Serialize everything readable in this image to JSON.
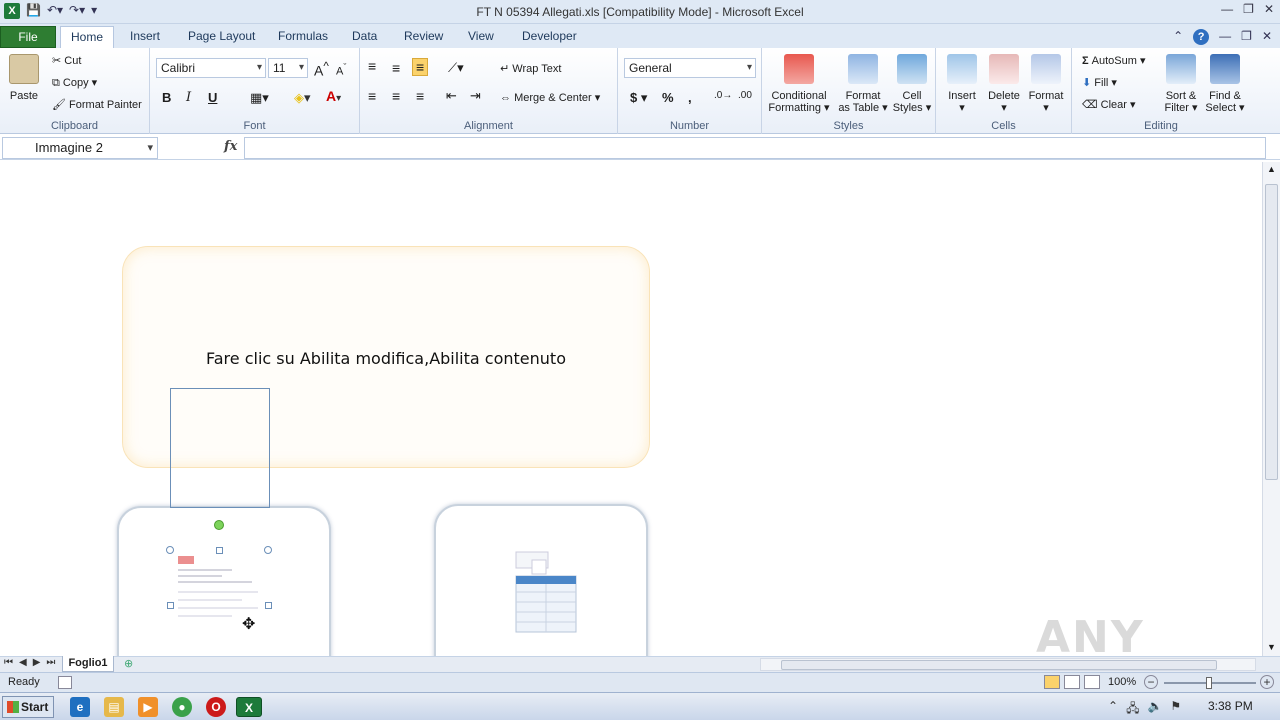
{
  "window": {
    "title": "FT N 05394 Allegati.xls  [Compatibility Mode]  -  Microsoft Excel",
    "app_icon_label": "X"
  },
  "ribbon_tabs": [
    "File",
    "Home",
    "Insert",
    "Page Layout",
    "Formulas",
    "Data",
    "Review",
    "View",
    "Developer"
  ],
  "active_tab": "Home",
  "clipboard": {
    "paste": "Paste",
    "cut": "Cut",
    "copy": "Copy",
    "format_painter": "Format Painter",
    "group": "Clipboard"
  },
  "font": {
    "name": "Calibri",
    "size": "11",
    "bold": "B",
    "italic": "I",
    "underline": "U",
    "group": "Font"
  },
  "alignment": {
    "wrap_text": "Wrap Text",
    "merge_center": "Merge & Center",
    "group": "Alignment"
  },
  "number": {
    "format": "General",
    "currency": "$",
    "percent": "%",
    "comma": ",",
    "group": "Number"
  },
  "styles": {
    "conditional_formatting_1": "Conditional",
    "conditional_formatting_2": "Formatting",
    "format_as_table_1": "Format",
    "format_as_table_2": "as Table",
    "cell_styles_1": "Cell",
    "cell_styles_2": "Styles",
    "group": "Styles"
  },
  "cells": {
    "insert": "Insert",
    "delete": "Delete",
    "format": "Format",
    "group": "Cells"
  },
  "editing": {
    "autosum": "AutoSum",
    "fill": "Fill",
    "clear": "Clear",
    "sort_filter_1": "Sort &",
    "sort_filter_2": "Filter",
    "find_select_1": "Find &",
    "find_select_2": "Select",
    "group": "Editing"
  },
  "formula_bar": {
    "name_box": "Immagine 2",
    "fx": "fx",
    "value": ""
  },
  "sheet_content": {
    "message": "Fare clic su Abilita modifica,Abilita contenuto"
  },
  "sheet_tabs": [
    "Foglio1"
  ],
  "status": {
    "ready": "Ready",
    "zoom": "100%"
  },
  "taskbar": {
    "start": "Start",
    "time": "3:38 PM"
  },
  "watermark": "ANY RUN",
  "colors": {
    "file_tab": "#2e7d32",
    "ribbon_bg": "#dfe9f5",
    "shape_border": "#f9e3b8"
  }
}
